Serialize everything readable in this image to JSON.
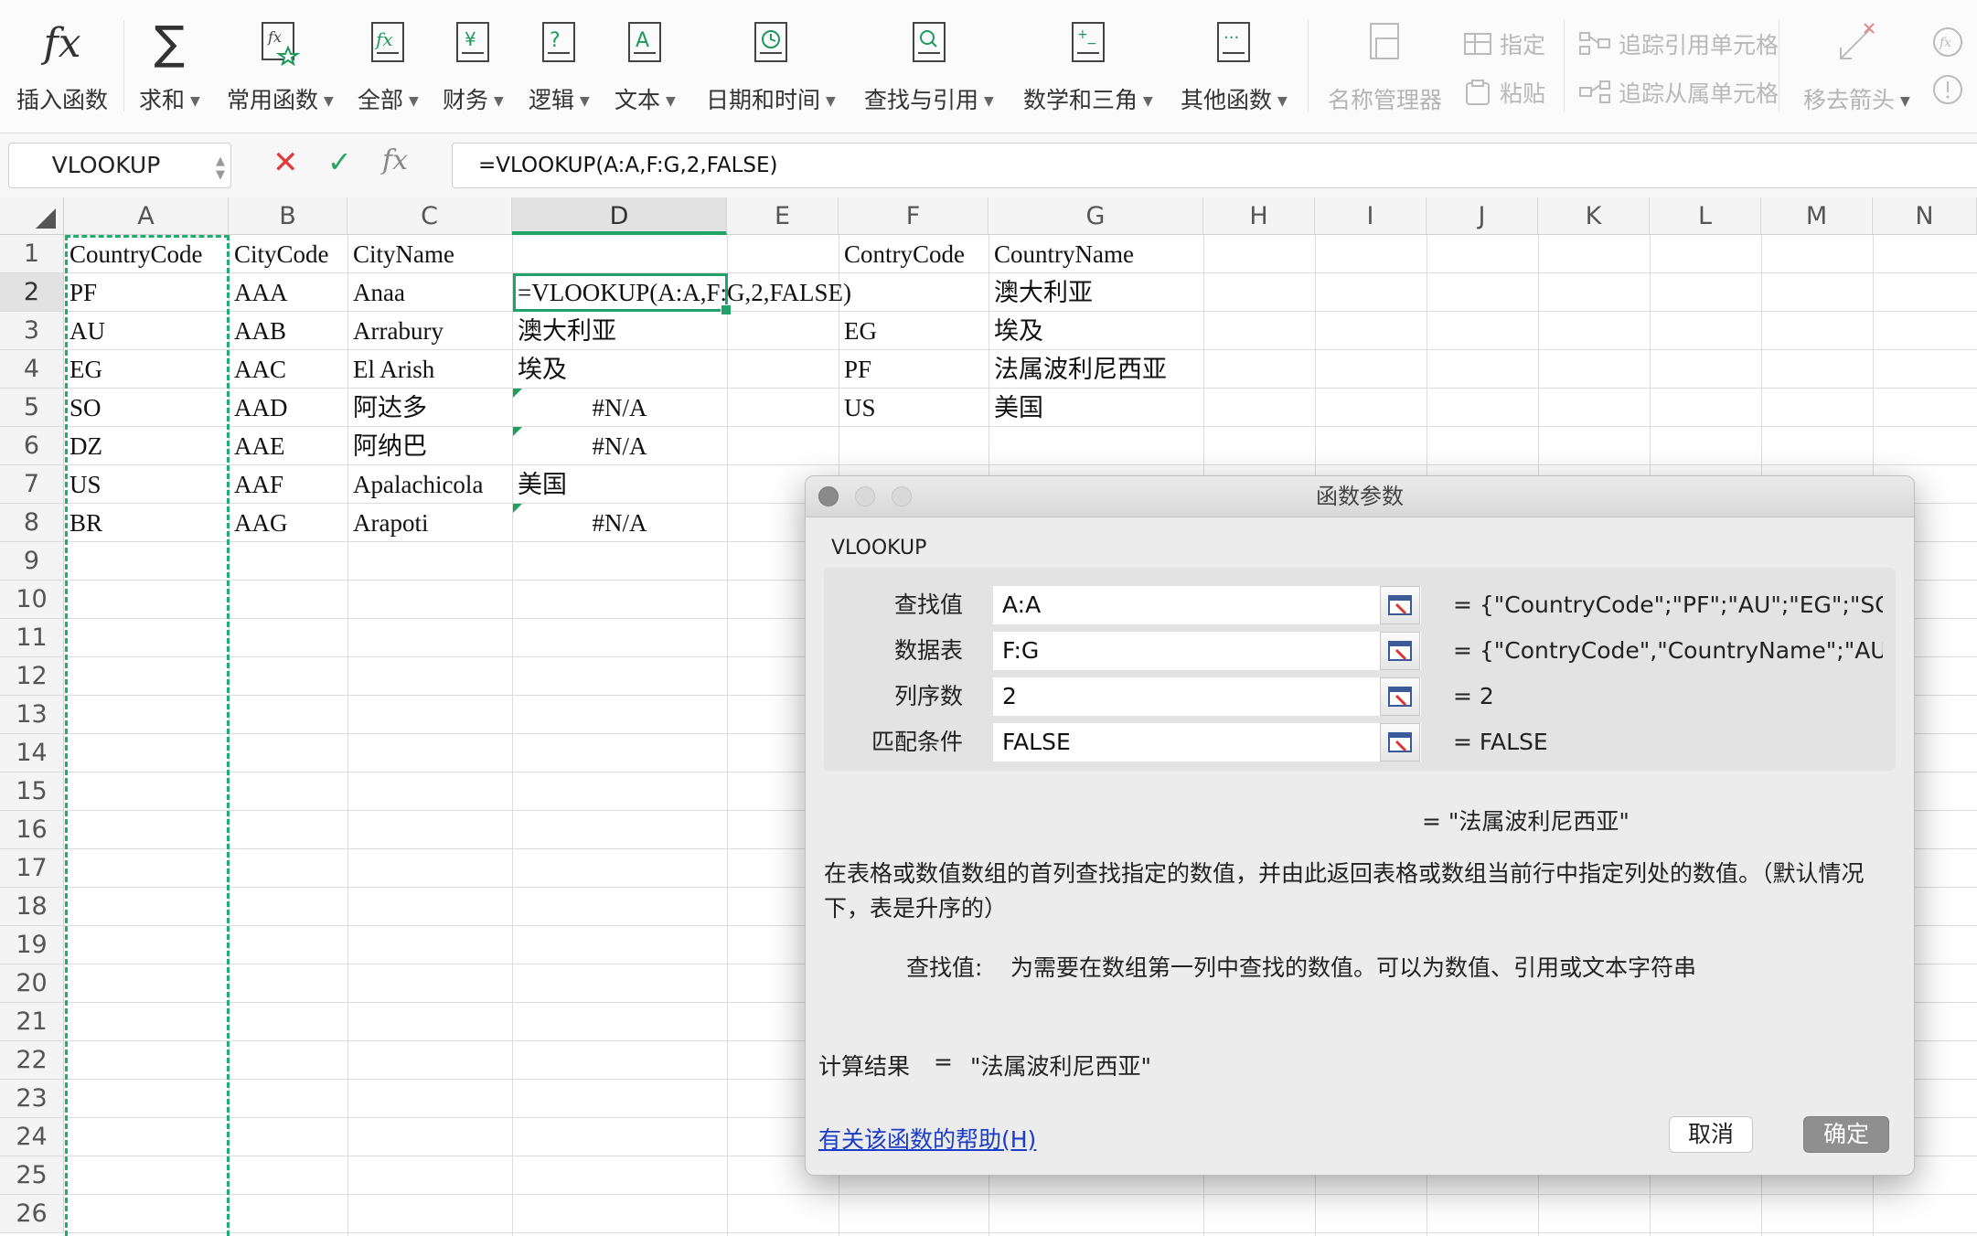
{
  "ribbon": {
    "buttons": [
      {
        "label": "插入函数",
        "dropdown": false
      },
      {
        "label": "求和",
        "dropdown": true
      },
      {
        "label": "常用函数",
        "dropdown": true
      },
      {
        "label": "全部",
        "dropdown": true
      },
      {
        "label": "财务",
        "dropdown": true
      },
      {
        "label": "逻辑",
        "dropdown": true
      },
      {
        "label": "文本",
        "dropdown": true
      },
      {
        "label": "日期和时间",
        "dropdown": true
      },
      {
        "label": "查找与引用",
        "dropdown": true
      },
      {
        "label": "数学和三角",
        "dropdown": true
      },
      {
        "label": "其他函数",
        "dropdown": true
      }
    ],
    "name_manager": "名称管理器",
    "define": "指定",
    "paste": "粘贴",
    "trace_precedents": "追踪引用单元格",
    "trace_dependents": "追踪从属单元格",
    "remove_arrows": "移去箭头"
  },
  "formula_bar": {
    "name_box": "VLOOKUP",
    "formula": "=VLOOKUP(A:A,F:G,2,FALSE)"
  },
  "sheet": {
    "columns": [
      "A",
      "B",
      "C",
      "D",
      "E",
      "F",
      "G",
      "H",
      "I",
      "J",
      "K",
      "L",
      "M",
      "N"
    ],
    "rows": [
      "1",
      "2",
      "3",
      "4",
      "5",
      "6",
      "7",
      "8",
      "9",
      "10",
      "11",
      "12",
      "13",
      "14",
      "15",
      "16",
      "17",
      "18",
      "19",
      "20",
      "21",
      "22",
      "23",
      "24",
      "25",
      "26"
    ],
    "col_a": [
      "CountryCode",
      "PF",
      "AU",
      "EG",
      "SO",
      "DZ",
      "US",
      "BR"
    ],
    "col_b": [
      "CityCode",
      "AAA",
      "AAB",
      "AAC",
      "AAD",
      "AAE",
      "AAF",
      "AAG"
    ],
    "col_c": [
      "CityName",
      "Anaa",
      "Arrabury",
      "El Arish",
      "阿达多",
      "阿纳巴",
      "Apalachicola",
      "Arapoti"
    ],
    "col_d": [
      "",
      "",
      "澳大利亚",
      "埃及",
      "#N/A",
      "#N/A",
      "美国",
      "#N/A"
    ],
    "col_f": [
      "ContryCode",
      "",
      "EG",
      "PF",
      "US"
    ],
    "col_g": [
      "CountryName",
      "澳大利亚",
      "埃及",
      "法属波利尼西亚",
      "美国"
    ],
    "editing": "=VLOOKUP(A:A,F:G,2,FALSE)"
  },
  "dialog": {
    "title": "函数参数",
    "function_name": "VLOOKUP",
    "args": [
      {
        "label": "查找值",
        "value": "A:A",
        "result": "= {\"CountryCode\";\"PF\";\"AU\";\"EG\";\"SO..."
      },
      {
        "label": "数据表",
        "value": "F:G",
        "result": "= {\"ContryCode\",\"CountryName\";\"AU..."
      },
      {
        "label": "列序数",
        "value": "2",
        "result": "= 2"
      },
      {
        "label": "匹配条件",
        "value": "FALSE",
        "result": "= FALSE"
      }
    ],
    "formula_result": "= \"法属波利尼西亚\"",
    "description": "在表格或数值数组的首列查找指定的数值，并由此返回表格或数组当前行中指定列处的数值。（默认情况下，表是升序的）",
    "arg_help_label": "查找值:",
    "arg_help_text": "为需要在数组第一列中查找的数值。可以为数值、引用或文本字符串",
    "calc_label": "计算结果",
    "calc_eq": "=",
    "calc_value": "\"法属波利尼西亚\"",
    "help_link": "有关该函数的帮助(H)",
    "cancel": "取消",
    "ok": "确定"
  }
}
